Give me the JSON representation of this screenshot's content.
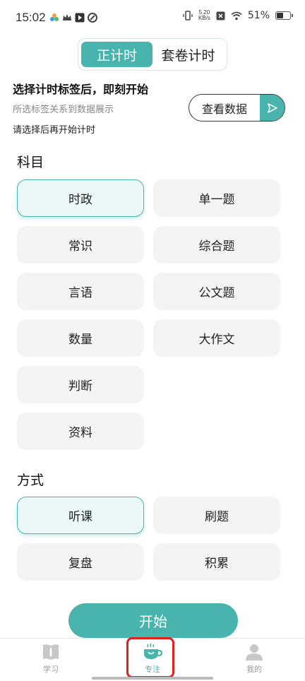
{
  "status_bar": {
    "time": "15:02",
    "net_speed_value": "5.20",
    "net_speed_unit": "KB/s",
    "battery": "51%",
    "battery_level": 0.51
  },
  "mode_toggle": {
    "options": [
      {
        "label": "正计时",
        "active": true
      },
      {
        "label": "套卷计时",
        "active": false
      }
    ]
  },
  "intro": {
    "headline": "选择计时标签后，即刻开始",
    "subline": "所选标签关系到数据展示",
    "hint": "请选择后再开始计时",
    "view_data_label": "查看数据"
  },
  "subjects": {
    "title": "科目",
    "items": [
      {
        "label": "时政",
        "selected": true
      },
      {
        "label": "单一题",
        "selected": false
      },
      {
        "label": "常识",
        "selected": false
      },
      {
        "label": "综合题",
        "selected": false
      },
      {
        "label": "言语",
        "selected": false
      },
      {
        "label": "公文题",
        "selected": false
      },
      {
        "label": "数量",
        "selected": false
      },
      {
        "label": "大作文",
        "selected": false
      },
      {
        "label": "判断",
        "selected": false
      },
      {
        "label": "资料",
        "selected": false
      }
    ]
  },
  "methods": {
    "title": "方式",
    "items": [
      {
        "label": "听课",
        "selected": true
      },
      {
        "label": "刷题",
        "selected": false
      },
      {
        "label": "复盘",
        "selected": false
      },
      {
        "label": "积累",
        "selected": false
      }
    ]
  },
  "start_label": "开始",
  "tabbar": {
    "items": [
      {
        "label": "学习",
        "icon": "book-icon",
        "active": false
      },
      {
        "label": "专注",
        "icon": "coffee-cup-icon",
        "active": true
      },
      {
        "label": "我的",
        "icon": "person-icon",
        "active": false
      }
    ]
  },
  "colors": {
    "accent": "#49b3ae",
    "selected_bg": "#ebf8f7",
    "chip_bg": "#f4f4f4",
    "highlight_outline": "#e0201c"
  }
}
